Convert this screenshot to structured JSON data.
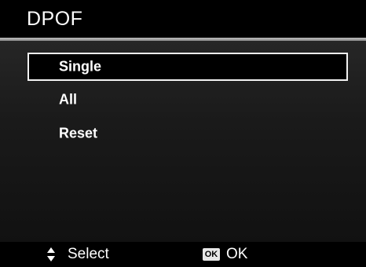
{
  "header": {
    "title": "DPOF"
  },
  "menu": {
    "selected_index": 0,
    "items": [
      {
        "label": "Single"
      },
      {
        "label": "All"
      },
      {
        "label": "Reset"
      }
    ]
  },
  "footer": {
    "select_icon": "up-down-arrows-icon",
    "select_label": "Select",
    "ok_icon_text": "OK",
    "ok_label": "OK"
  },
  "colors": {
    "background": "#000000",
    "text": "#ffffff",
    "selection_border": "#f2f2f2",
    "header_rule": "#bdbdbd"
  }
}
